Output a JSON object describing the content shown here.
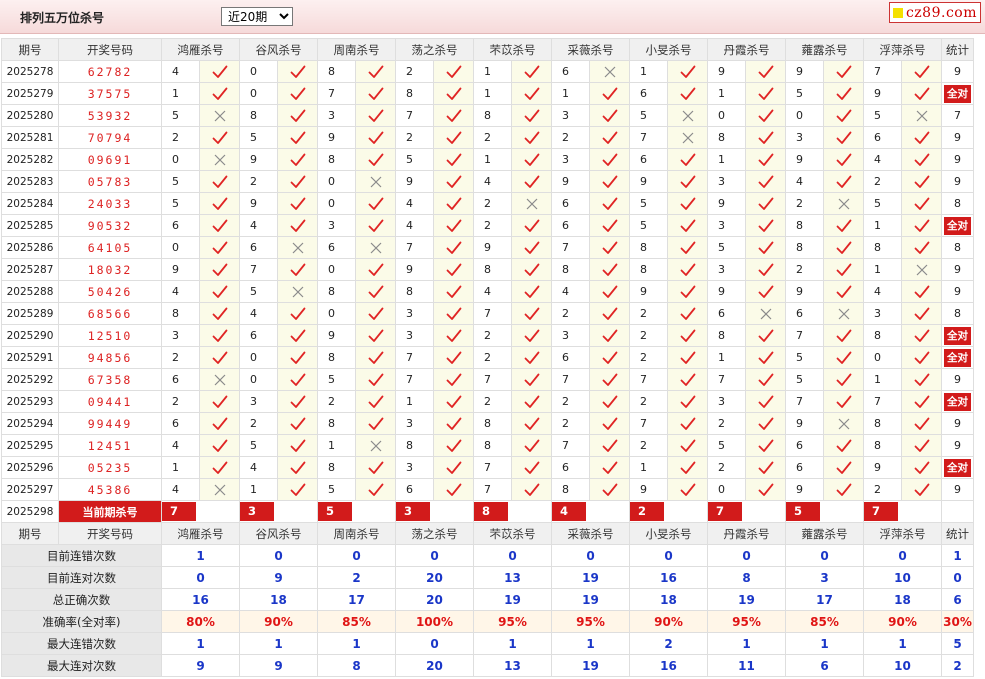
{
  "page": {
    "title": "排列五万位杀号",
    "select": {
      "value": "近20期",
      "options": [
        "近20期"
      ]
    },
    "logo": "cz89.com"
  },
  "columns": {
    "period": "期号",
    "draw": "开奖号码",
    "experts": [
      "鸿雁杀号",
      "谷风杀号",
      "周南杀号",
      "荡之杀号",
      "芣苡杀号",
      "采薇杀号",
      "小旻杀号",
      "丹霞杀号",
      "蕹露杀号",
      "浮萍杀号"
    ],
    "total": "统计"
  },
  "all_correct_label": "全对",
  "rows": [
    {
      "period": "2025278",
      "draw": "62782",
      "kills": [
        "4",
        "0",
        "8",
        "2",
        "1",
        "6",
        "1",
        "9",
        "9",
        "7"
      ],
      "ok": [
        1,
        1,
        1,
        1,
        1,
        0,
        1,
        1,
        1,
        1
      ],
      "total": "9"
    },
    {
      "period": "2025279",
      "draw": "37575",
      "kills": [
        "1",
        "0",
        "7",
        "8",
        "1",
        "1",
        "6",
        "1",
        "5",
        "9"
      ],
      "ok": [
        1,
        1,
        1,
        1,
        1,
        1,
        1,
        1,
        1,
        1
      ],
      "total": "全对"
    },
    {
      "period": "2025280",
      "draw": "53932",
      "kills": [
        "5",
        "8",
        "3",
        "7",
        "8",
        "3",
        "5",
        "0",
        "0",
        "5"
      ],
      "ok": [
        0,
        1,
        1,
        1,
        1,
        1,
        0,
        1,
        1,
        0
      ],
      "total": "7"
    },
    {
      "period": "2025281",
      "draw": "70794",
      "kills": [
        "2",
        "5",
        "9",
        "2",
        "2",
        "2",
        "7",
        "8",
        "3",
        "6"
      ],
      "ok": [
        1,
        1,
        1,
        1,
        1,
        1,
        0,
        1,
        1,
        1
      ],
      "total": "9"
    },
    {
      "period": "2025282",
      "draw": "09691",
      "kills": [
        "0",
        "9",
        "8",
        "5",
        "1",
        "3",
        "6",
        "1",
        "9",
        "4"
      ],
      "ok": [
        0,
        1,
        1,
        1,
        1,
        1,
        1,
        1,
        1,
        1
      ],
      "total": "9"
    },
    {
      "period": "2025283",
      "draw": "05783",
      "kills": [
        "5",
        "2",
        "0",
        "9",
        "4",
        "9",
        "9",
        "3",
        "4",
        "2"
      ],
      "ok": [
        1,
        1,
        0,
        1,
        1,
        1,
        1,
        1,
        1,
        1
      ],
      "total": "9"
    },
    {
      "period": "2025284",
      "draw": "24033",
      "kills": [
        "5",
        "9",
        "0",
        "4",
        "2",
        "6",
        "5",
        "9",
        "2",
        "5"
      ],
      "ok": [
        1,
        1,
        1,
        1,
        0,
        1,
        1,
        1,
        0,
        1
      ],
      "total": "8"
    },
    {
      "period": "2025285",
      "draw": "90532",
      "kills": [
        "6",
        "4",
        "3",
        "4",
        "2",
        "6",
        "5",
        "3",
        "8",
        "1"
      ],
      "ok": [
        1,
        1,
        1,
        1,
        1,
        1,
        1,
        1,
        1,
        1
      ],
      "total": "全对"
    },
    {
      "period": "2025286",
      "draw": "64105",
      "kills": [
        "0",
        "6",
        "6",
        "7",
        "9",
        "7",
        "8",
        "5",
        "8",
        "8"
      ],
      "ok": [
        1,
        0,
        0,
        1,
        1,
        1,
        1,
        1,
        1,
        1
      ],
      "total": "8"
    },
    {
      "period": "2025287",
      "draw": "18032",
      "kills": [
        "9",
        "7",
        "0",
        "9",
        "8",
        "8",
        "8",
        "3",
        "2",
        "1"
      ],
      "ok": [
        1,
        1,
        1,
        1,
        1,
        1,
        1,
        1,
        1,
        0
      ],
      "total": "9"
    },
    {
      "period": "2025288",
      "draw": "50426",
      "kills": [
        "4",
        "5",
        "8",
        "8",
        "4",
        "4",
        "9",
        "9",
        "9",
        "4"
      ],
      "ok": [
        1,
        0,
        1,
        1,
        1,
        1,
        1,
        1,
        1,
        1
      ],
      "total": "9"
    },
    {
      "period": "2025289",
      "draw": "68566",
      "kills": [
        "8",
        "4",
        "0",
        "3",
        "7",
        "2",
        "2",
        "6",
        "6",
        "3"
      ],
      "ok": [
        1,
        1,
        1,
        1,
        1,
        1,
        1,
        0,
        0,
        1
      ],
      "total": "8"
    },
    {
      "period": "2025290",
      "draw": "12510",
      "kills": [
        "3",
        "6",
        "9",
        "3",
        "2",
        "3",
        "2",
        "8",
        "7",
        "8"
      ],
      "ok": [
        1,
        1,
        1,
        1,
        1,
        1,
        1,
        1,
        1,
        1
      ],
      "total": "全对"
    },
    {
      "period": "2025291",
      "draw": "94856",
      "kills": [
        "2",
        "0",
        "8",
        "7",
        "2",
        "6",
        "2",
        "1",
        "5",
        "0"
      ],
      "ok": [
        1,
        1,
        1,
        1,
        1,
        1,
        1,
        1,
        1,
        1
      ],
      "total": "全对"
    },
    {
      "period": "2025292",
      "draw": "67358",
      "kills": [
        "6",
        "0",
        "5",
        "7",
        "7",
        "7",
        "7",
        "7",
        "5",
        "1"
      ],
      "ok": [
        0,
        1,
        1,
        1,
        1,
        1,
        1,
        1,
        1,
        1
      ],
      "total": "9"
    },
    {
      "period": "2025293",
      "draw": "09441",
      "kills": [
        "2",
        "3",
        "2",
        "1",
        "2",
        "2",
        "2",
        "3",
        "7",
        "7"
      ],
      "ok": [
        1,
        1,
        1,
        1,
        1,
        1,
        1,
        1,
        1,
        1
      ],
      "total": "全对"
    },
    {
      "period": "2025294",
      "draw": "99449",
      "kills": [
        "6",
        "2",
        "8",
        "3",
        "8",
        "2",
        "7",
        "2",
        "9",
        "8"
      ],
      "ok": [
        1,
        1,
        1,
        1,
        1,
        1,
        1,
        1,
        0,
        1
      ],
      "total": "9"
    },
    {
      "period": "2025295",
      "draw": "12451",
      "kills": [
        "4",
        "5",
        "1",
        "8",
        "8",
        "7",
        "2",
        "5",
        "6",
        "8"
      ],
      "ok": [
        1,
        1,
        0,
        1,
        1,
        1,
        1,
        1,
        1,
        1
      ],
      "total": "9"
    },
    {
      "period": "2025296",
      "draw": "05235",
      "kills": [
        "1",
        "4",
        "8",
        "3",
        "7",
        "6",
        "1",
        "2",
        "6",
        "9"
      ],
      "ok": [
        1,
        1,
        1,
        1,
        1,
        1,
        1,
        1,
        1,
        1
      ],
      "total": "全对"
    },
    {
      "period": "2025297",
      "draw": "45386",
      "kills": [
        "4",
        "1",
        "5",
        "6",
        "7",
        "8",
        "9",
        "0",
        "9",
        "2"
      ],
      "ok": [
        0,
        1,
        1,
        1,
        1,
        1,
        1,
        1,
        1,
        1
      ],
      "total": "9"
    }
  ],
  "current": {
    "period": "2025298",
    "label": "当前期杀号",
    "kills": [
      "7",
      "3",
      "5",
      "3",
      "8",
      "4",
      "2",
      "7",
      "5",
      "7"
    ]
  },
  "stats": [
    {
      "label": "目前连错次数",
      "values": [
        "1",
        "0",
        "0",
        "0",
        "0",
        "0",
        "0",
        "0",
        "0",
        "0"
      ],
      "total": "1",
      "color": "blue"
    },
    {
      "label": "目前连对次数",
      "values": [
        "0",
        "9",
        "2",
        "20",
        "13",
        "19",
        "16",
        "8",
        "3",
        "10"
      ],
      "total": "0",
      "color": "blue"
    },
    {
      "label": "总正确次数",
      "values": [
        "16",
        "18",
        "17",
        "20",
        "19",
        "19",
        "18",
        "19",
        "17",
        "18"
      ],
      "total": "6",
      "color": "blue"
    },
    {
      "label": "准确率(全对率)",
      "values": [
        "80%",
        "90%",
        "85%",
        "100%",
        "95%",
        "95%",
        "90%",
        "95%",
        "85%",
        "90%"
      ],
      "total": "30%",
      "color": "red"
    },
    {
      "label": "最大连错次数",
      "values": [
        "1",
        "1",
        "1",
        "0",
        "1",
        "1",
        "2",
        "1",
        "1",
        "1"
      ],
      "total": "5",
      "color": "blue"
    },
    {
      "label": "最大连对次数",
      "values": [
        "9",
        "9",
        "8",
        "20",
        "13",
        "19",
        "16",
        "11",
        "6",
        "10"
      ],
      "total": "2",
      "color": "blue"
    }
  ]
}
